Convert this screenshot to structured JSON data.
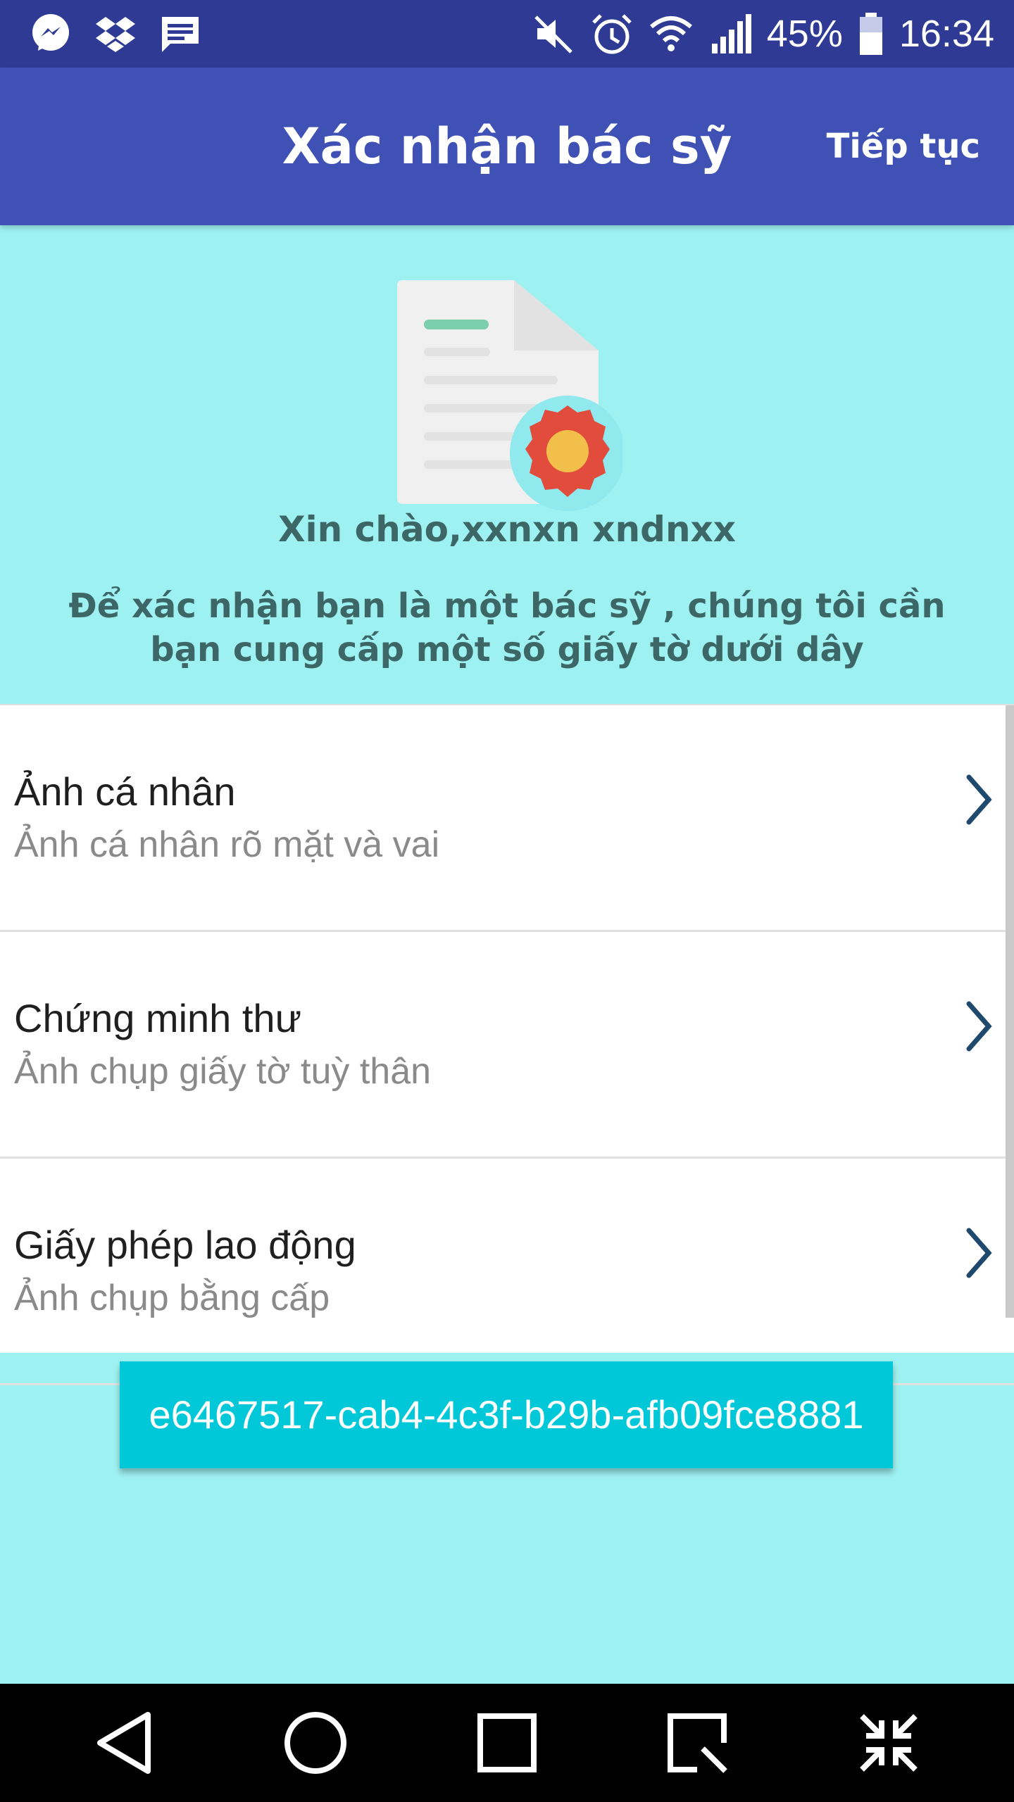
{
  "status_bar": {
    "battery": "45%",
    "time": "16:34",
    "icons_left": [
      "messenger-icon",
      "dropbox-icon",
      "message-icon"
    ],
    "icons_right": [
      "mute-icon",
      "alarm-icon",
      "wifi-icon",
      "signal-icon",
      "battery-icon"
    ]
  },
  "toolbar": {
    "title": "Xác nhận bác sỹ",
    "action": "Tiếp tục"
  },
  "hero": {
    "illustration": "certificate-document-icon",
    "greeting": "Xin chào,xxnxn xndnxx",
    "instruction": "Để xác nhận bạn là một bác sỹ , chúng tôi cần bạn cung cấp một số giấy tờ dưới dây"
  },
  "items": [
    {
      "title": "Ảnh cá nhân",
      "subtitle": "Ảnh cá nhân rõ mặt và vai"
    },
    {
      "title": "Chứng minh thư",
      "subtitle": "Ảnh chụp giấy tờ tuỳ thân"
    },
    {
      "title": "Giấy phép lao động",
      "subtitle": "Ảnh chụp bằng cấp"
    }
  ],
  "id_button": {
    "label": "e6467517-cab4-4c3f-b29b-afb09fce8881"
  },
  "navbar": {
    "icons": [
      "back-icon",
      "home-icon",
      "recents-icon",
      "screen-capture-icon",
      "collapse-icon"
    ]
  },
  "colors": {
    "status_bar": "#2e3a94",
    "toolbar": "#3f51b5",
    "background": "#9ef1f1",
    "button": "#00c8d8",
    "chevron": "#1f4a6e"
  }
}
